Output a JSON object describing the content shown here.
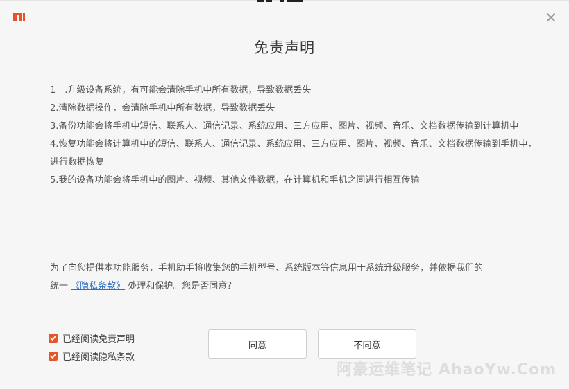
{
  "header": {
    "logo_icon": "mi-logo-icon",
    "logo_text": "MI",
    "close_icon": "close-icon",
    "title": "免责声明"
  },
  "terms": {
    "items": [
      "1　.升级设备系统，有可能会清除手机中所有数据，导致数据丢失",
      "2.清除数据操作，会清除手机中所有数据，导致数据丢失",
      "3.备份功能会将手机中短信、联系人、通信记录、系统应用、三方应用、图片、视频、音乐、文档数据传输到计算机中",
      "4.恢复功能会将计算机中的短信、联系人、通信记录、系统应用、三方应用、图片、视频、音乐、文档数据传输到手机中，进行数据恢复",
      "5.我的设备功能会将手机中的图片、视频、其他文件数据，在计算机和手机之间进行相互传输"
    ]
  },
  "notice": {
    "line1": "为了向您提供本功能服务，手机助手将收集您的手机型号、系统版本等信息用于系统升级服务，并依据我们的",
    "line2_prefix": "统一 ",
    "privacy_link": "《隐私条款》",
    "line2_suffix": " 处理和保护。您是否同意？"
  },
  "checkboxes": [
    {
      "label": "已经阅读免责声明",
      "checked": true
    },
    {
      "label": "已经阅读隐私条款",
      "checked": true
    }
  ],
  "buttons": {
    "agree": "同意",
    "disagree": "不同意"
  },
  "watermark": "阿豪运维笔记 AhaoYw.Com",
  "colors": {
    "accent": "#e8542a",
    "link": "#2f6fc0",
    "background": "#f6f6f6"
  }
}
